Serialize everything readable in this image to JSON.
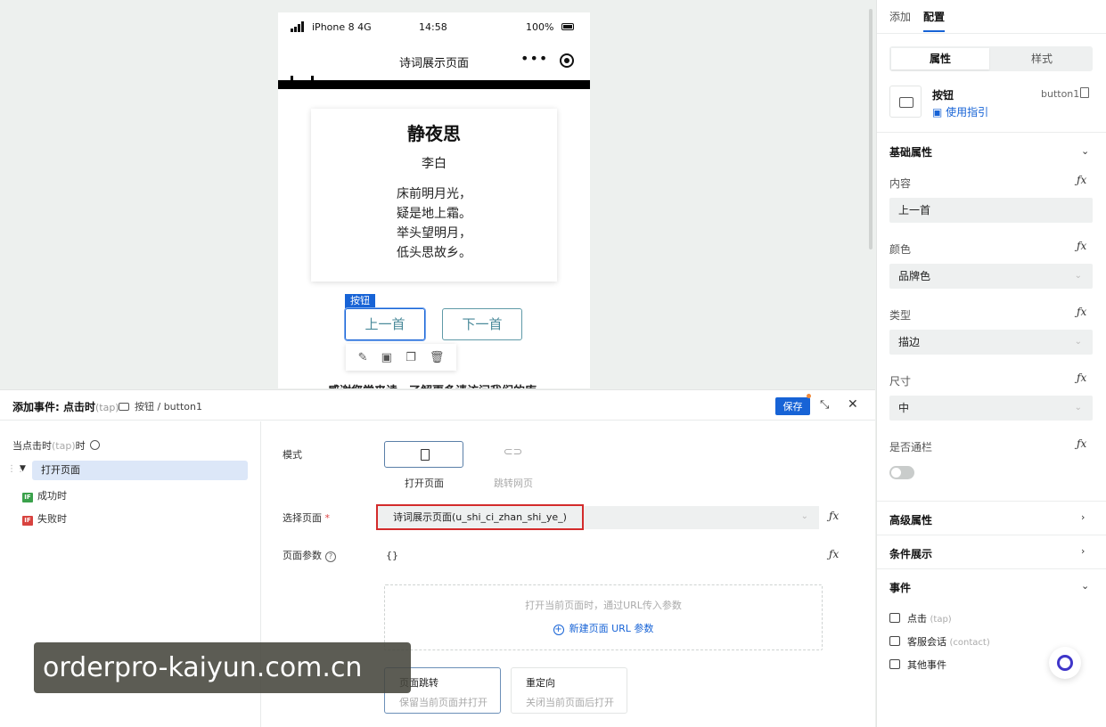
{
  "phone": {
    "carrier": "iPhone 8  4G",
    "time": "14:58",
    "battery": "100%",
    "nav_title": "诗词展示页面",
    "more": "•••",
    "poem": {
      "title": "静夜思",
      "author": "李白",
      "lines": [
        "床前明月光，",
        "疑是地上霜。",
        "举头望明月，",
        "低头思故乡。"
      ]
    },
    "selected_badge": "按钮",
    "prev_button": "上一首",
    "next_button": "下一首",
    "partial_text": "感谢您常来读，了解更多请访问我们的库"
  },
  "right_panel": {
    "tabs": [
      {
        "label": "添加"
      },
      {
        "label": "配置"
      }
    ],
    "segment": {
      "on": "属性",
      "off": "样式"
    },
    "component": {
      "name": "按钮",
      "guide": "使用指引",
      "id": "button1"
    },
    "basic_section": "基础属性",
    "fx": "ƒx",
    "props": {
      "content_label": "内容",
      "content_value": "上一首",
      "color_label": "颜色",
      "color_value": "品牌色",
      "type_label": "类型",
      "type_value": "描边",
      "size_label": "尺寸",
      "size_value": "中",
      "full_label": "是否通栏"
    },
    "advanced_section": "高级属性",
    "condition_section": "条件展示",
    "events_section": "事件",
    "events": [
      {
        "label": "点击",
        "sub": "(tap)"
      },
      {
        "label": "客服会话",
        "sub": "(contact)"
      },
      {
        "label": "其他事件",
        "sub": ""
      }
    ]
  },
  "event_panel": {
    "title": "添加事件: 点击时",
    "title_sub": "(tap)",
    "target": "按钮 / button1",
    "save": "保存",
    "tree": {
      "root": "当点击时",
      "root_sub": "(tap)",
      "root_tail": "时",
      "open_page": "打开页面",
      "if_badge": "IF",
      "success": "成功时",
      "fail": "失败时"
    },
    "mode_label": "模式",
    "mode_open": "打开页面",
    "mode_jump": "跳转网页",
    "page_label": "选择页面",
    "required": "*",
    "page_value": "诗词展示页面(u_shi_ci_zhan_shi_ye_)",
    "params_label": "页面参数",
    "params_value": "{}",
    "param_hint": "打开当前页面时，通过URL传入参数",
    "add_param": "新建页面 URL 参数",
    "nav_push": {
      "title": "页面跳转",
      "desc": "保留当前页面并打开"
    },
    "nav_redirect": {
      "title": "重定向",
      "desc": "关闭当前页面后打开"
    }
  },
  "watermark": "orderpro-kaiyun.com.cn",
  "colors": {
    "accent": "#1763d6",
    "highlight_red": "#d32b2b"
  }
}
